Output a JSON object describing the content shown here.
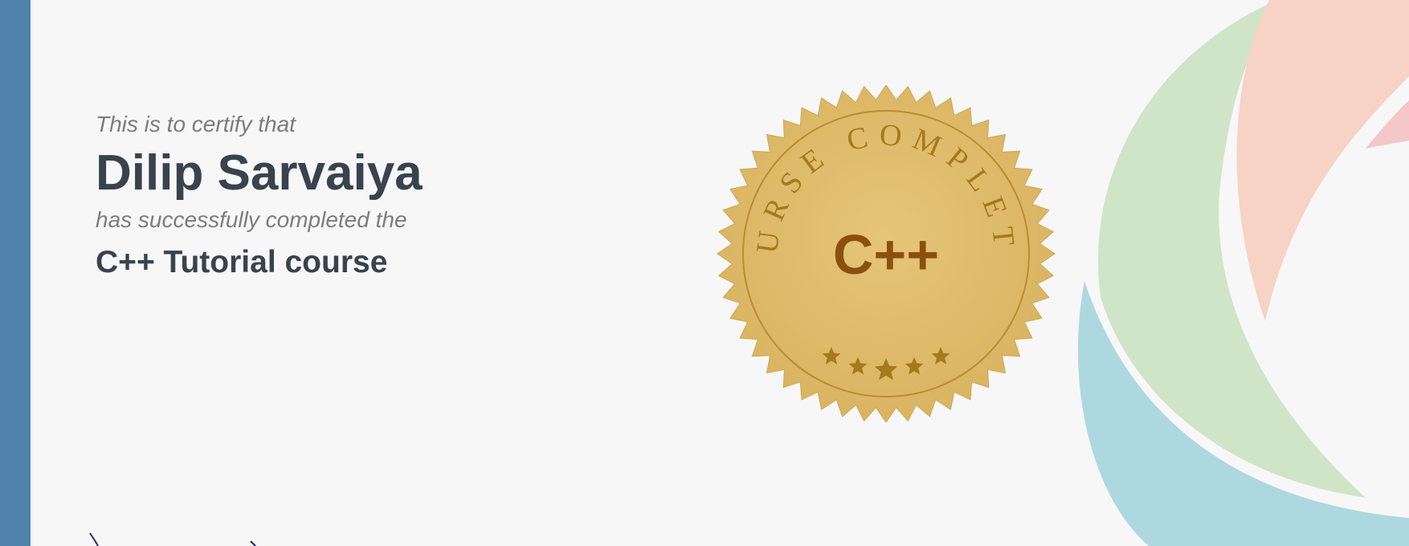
{
  "certificate": {
    "intro": "This is to certify that",
    "recipient": "Dilip Sarvaiya",
    "completed_text": "has successfully completed the",
    "course": "C++ Tutorial course"
  },
  "seal": {
    "top_text": "COURSE COMPLETED",
    "language": "C++",
    "stars": 5
  },
  "colors": {
    "left_bar": "#5082ac",
    "background": "#f7f7f8",
    "heading": "#38434d",
    "subtext": "#7c7c7c",
    "seal_gold": "#e0bc6d",
    "seal_text": "#a57a1b",
    "deco_green": "#d0e5c7",
    "deco_peach": "#f6d3c4",
    "deco_blue": "#aed8df",
    "deco_pink": "#f4c7c8"
  }
}
